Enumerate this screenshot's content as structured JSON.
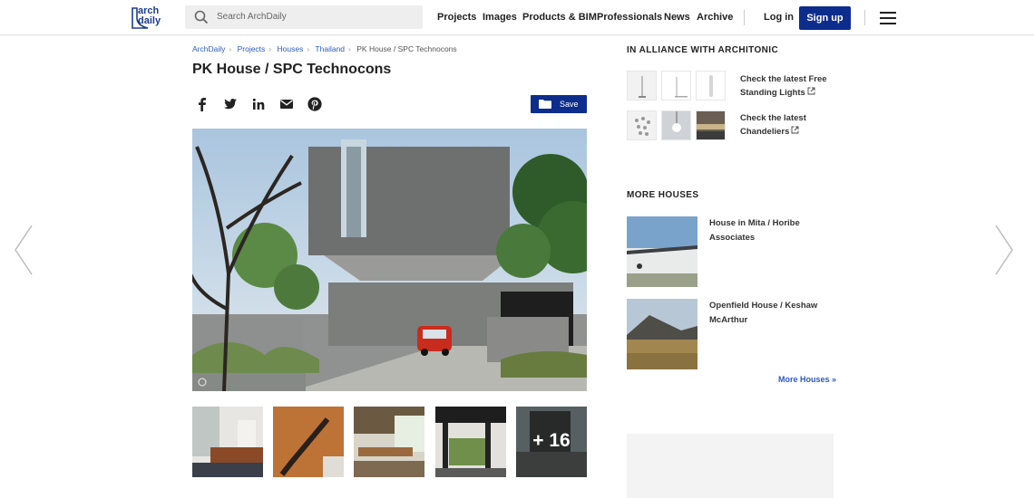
{
  "header": {
    "logo_lines": [
      "arch",
      "daily"
    ],
    "search_placeholder": "Search ArchDaily",
    "nav": [
      "Projects",
      "Images",
      "Products & BIM",
      "Professionals",
      "News",
      "Archive"
    ],
    "login_label": "Log in",
    "signup_label": "Sign up"
  },
  "breadcrumb": [
    "ArchDaily",
    "Projects",
    "Houses",
    "Thailand",
    "PK House / SPC Technocons"
  ],
  "article": {
    "title": "PK House / SPC Technocons",
    "share_icons": [
      "facebook-icon",
      "twitter-icon",
      "linkedin-icon",
      "email-icon",
      "pinterest-icon"
    ],
    "save_label": "Save",
    "more_images_count": "+ 16"
  },
  "alliance": {
    "heading": "IN ALLIANCE WITH ARCHITONIC",
    "items": [
      {
        "text": "Check the latest Free Standing Lights"
      },
      {
        "text": "Check the latest Chandeliers"
      }
    ]
  },
  "more_houses": {
    "heading": "MORE HOUSES",
    "items": [
      {
        "title": "House in Mita / Horibe Associates"
      },
      {
        "title": "Openfield House / Keshaw McArthur"
      }
    ],
    "more_link": "More Houses »"
  },
  "colors": {
    "brand_blue": "#0d2d8c",
    "link_blue": "#2b59c3"
  }
}
